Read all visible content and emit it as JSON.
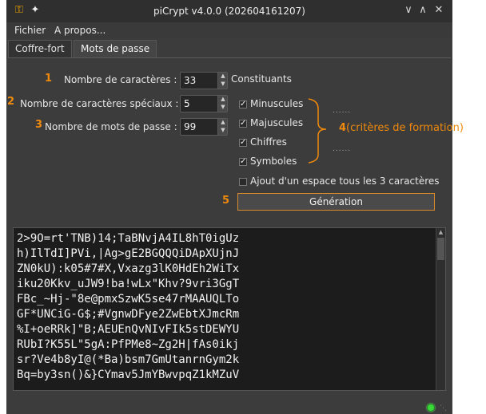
{
  "window": {
    "title": "piCrypt v4.0.0 (202604161207)",
    "icons": [
      "key-icon",
      "pin-icon"
    ],
    "controls": [
      "minimize-icon",
      "maximize-icon",
      "close-icon"
    ]
  },
  "menu": {
    "file": "Fichier",
    "about": "A propos..."
  },
  "tabs": {
    "vault": "Coffre-fort",
    "passwords": "Mots de passe"
  },
  "form": {
    "chars": {
      "num": "1",
      "label": "Nombre de caractères :",
      "value": "33"
    },
    "special": {
      "num": "2",
      "label": "Nombre de caractères spéciaux :",
      "value": "5"
    },
    "count": {
      "num": "3",
      "label": "Nombre de mots de passe :",
      "value": "99"
    }
  },
  "constituents": {
    "title": "Constituants",
    "lowercase": "Minuscules",
    "uppercase": "Majuscules",
    "digits": "Chiffres",
    "symbols": "Symboles",
    "space": "Ajout d'un espace tous les 3 caractères",
    "annot_num": "4",
    "annot_text": "(critères de formation)",
    "dots": "......"
  },
  "generate": {
    "num": "5",
    "label": "Génération"
  },
  "output": "2>9O=rt'TNB)14;TaBNvjA4IL8hT0igUz\nh)IlTdI]PVi,|Ag>gE2BGQQQiDApXUjnJ\nZN0kU):k05#7#X,Vxazg3lK0HdEh2WiTx\niku20Kkv_uJW9!ba!wLx\"Khv?9vri3GgT\nFBc_~Hj-\"8e@pmxSzwK5se47rMAAUQLTo\nGF*UNCiG-G$;#VgnwDFye2ZwEbtXJmcRm\n%I+oeRRk]\"B;AEUEnQvNIvFIk5stDEWYU\nRUbI?K55L\"5gA:PfPMe8~Zg2H|fAs0ikj\nsr?Ve4b8yI@(*Ba)bsm7GmUtanrnGym2k\nBq=by3sn()&}CYmav5JmYBwvpqZ1kMZuV"
}
